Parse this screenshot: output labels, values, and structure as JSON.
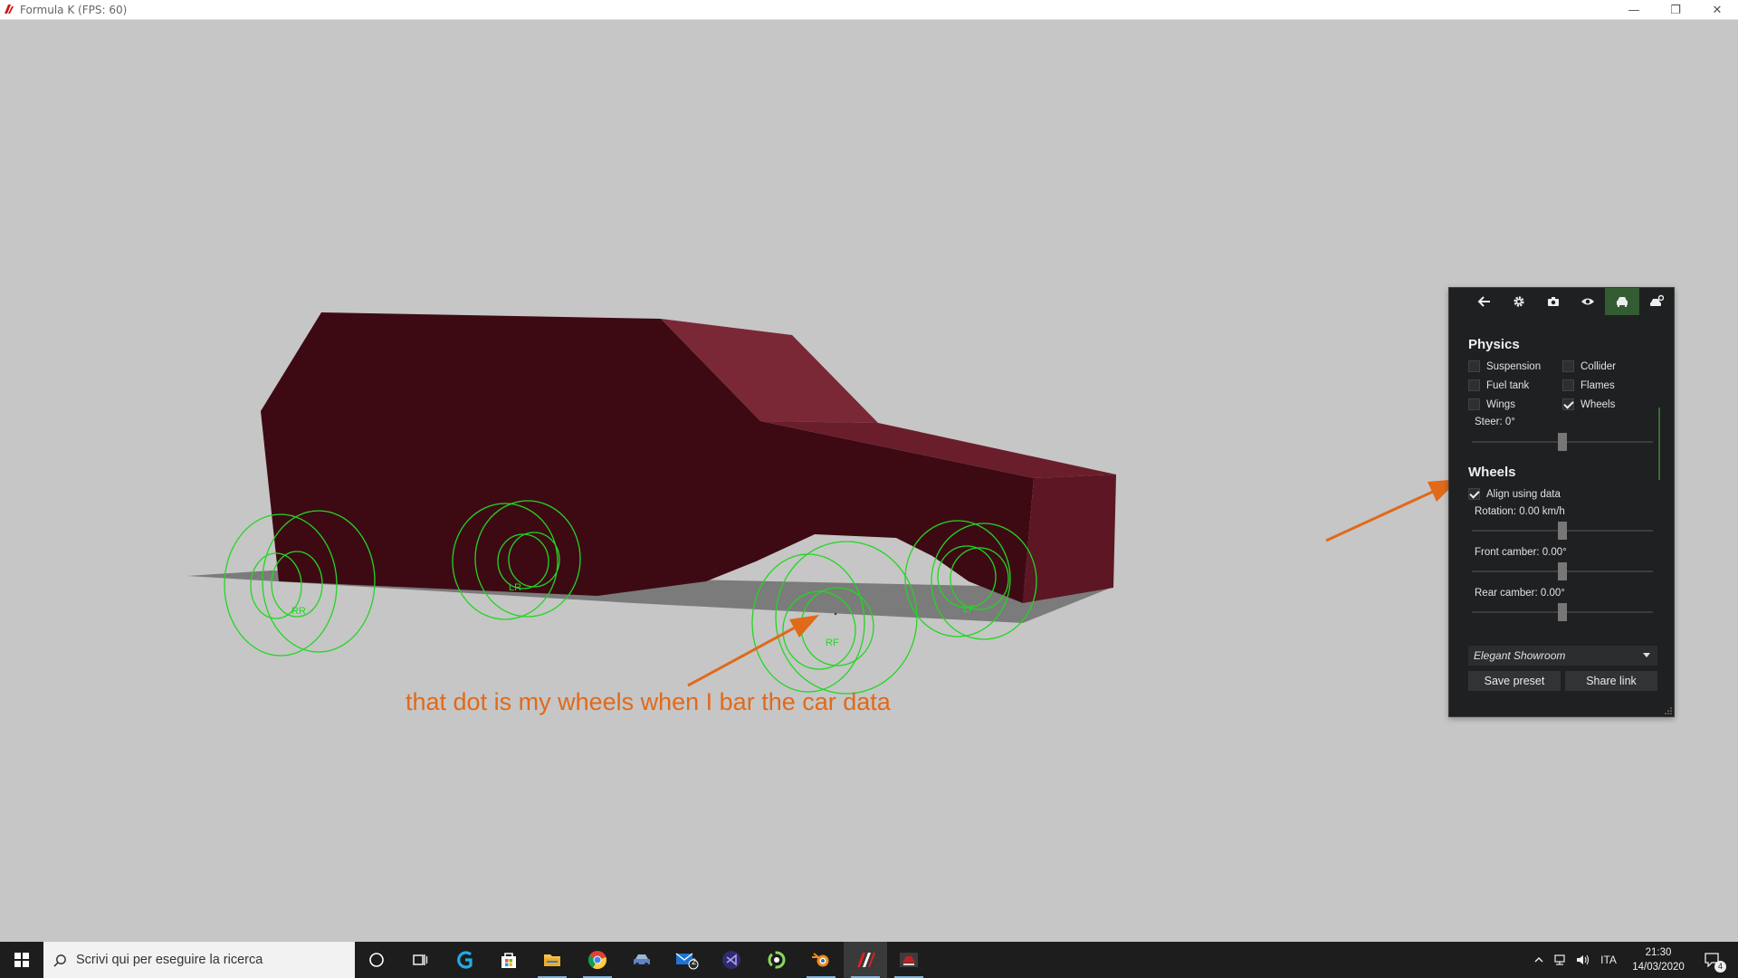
{
  "window": {
    "title": "Formula K (FPS: 60)",
    "minimize": "—",
    "maximize": "❐",
    "close": "✕"
  },
  "scene": {
    "wheel_labels": [
      "RR",
      "LR",
      "RF",
      "LF"
    ],
    "annotation": "that dot is my wheels when I bar the car data",
    "colors": {
      "body_dark": "#3d0a14",
      "body_mid": "#5c1624",
      "body_light": "#7a2836",
      "wheel": "#22d622",
      "arrow": "#e06a1a",
      "shadow": "#7a7a7a"
    }
  },
  "panel": {
    "tabs": [
      "back-arrow-icon",
      "gear-icon",
      "camera-icon",
      "eye-icon",
      "car-icon",
      "car-settings-icon"
    ],
    "active_tab": "car-icon",
    "physics": {
      "title": "Physics",
      "options": [
        {
          "label": "Suspension",
          "checked": false
        },
        {
          "label": "Collider",
          "checked": false
        },
        {
          "label": "Fuel tank",
          "checked": false
        },
        {
          "label": "Flames",
          "checked": false
        },
        {
          "label": "Wings",
          "checked": false
        },
        {
          "label": "Wheels",
          "checked": true
        }
      ],
      "steer_label": "Steer: 0°",
      "steer_value": 0.5
    },
    "wheels": {
      "title": "Wheels",
      "align_label": "Align using data",
      "align_checked": true,
      "rotation_label": "Rotation: 0.00 km/h",
      "rotation_value": 0.5,
      "front_camber_label": "Front camber: 0.00°",
      "front_camber_value": 0.5,
      "rear_camber_label": "Rear camber: 0.00°",
      "rear_camber_value": 0.5
    },
    "preset_select": "Elegant Showroom",
    "save_preset": "Save preset",
    "share_link": "Share link"
  },
  "taskbar": {
    "search_placeholder": "Scrivi qui per eseguire la ricerca",
    "mail_badge": "2",
    "language": "ITA",
    "time": "21:30",
    "date": "14/03/2020",
    "notification_count": "4"
  }
}
